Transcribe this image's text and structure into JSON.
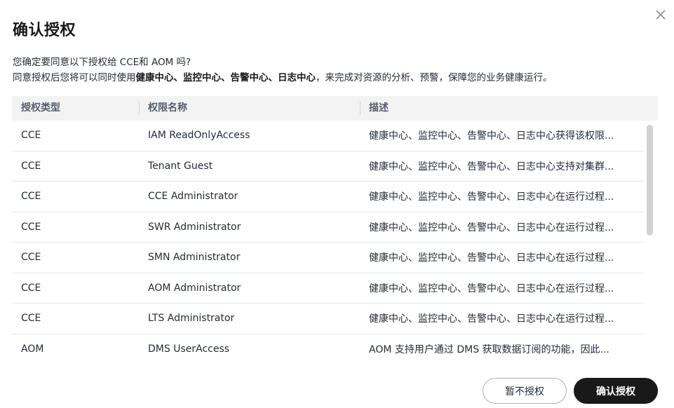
{
  "dialog": {
    "title": "确认授权",
    "desc_line1": "您确定要同意以下授权给 CCE和 AOM 吗?",
    "desc_line2_prefix": "同意授权后您将可以同时使用",
    "desc_line2_bold": "健康中心、监控中心、告警中心、日志中心",
    "desc_line2_suffix": "，来完成对资源的分析、预警，保障您的业务健康运行。",
    "close_icon": "close-icon"
  },
  "table": {
    "headers": [
      "授权类型",
      "权限名称",
      "描述"
    ],
    "rows": [
      {
        "type": "CCE",
        "name": "IAM ReadOnlyAccess",
        "desc": "健康中心、监控中心、告警中心、日志中心获得该权限..."
      },
      {
        "type": "CCE",
        "name": "Tenant Guest",
        "desc": "健康中心、监控中心、告警中心、日志中心支持对集群..."
      },
      {
        "type": "CCE",
        "name": "CCE Administrator",
        "desc": "健康中心、监控中心、告警中心、日志中心在运行过程..."
      },
      {
        "type": "CCE",
        "name": "SWR Administrator",
        "desc": "健康中心、监控中心、告警中心、日志中心在运行过程..."
      },
      {
        "type": "CCE",
        "name": "SMN Administrator",
        "desc": "健康中心、监控中心、告警中心、日志中心在运行过程..."
      },
      {
        "type": "CCE",
        "name": "AOM Administrator",
        "desc": "健康中心、监控中心、告警中心、日志中心在运行过程..."
      },
      {
        "type": "CCE",
        "name": "LTS Administrator",
        "desc": "健康中心、监控中心、告警中心、日志中心在运行过程..."
      },
      {
        "type": "AOM",
        "name": "DMS UserAccess",
        "desc": "AOM 支持用户通过 DMS 获取数据订阅的功能，因此..."
      }
    ]
  },
  "footer": {
    "cancel_label": "暂不授权",
    "confirm_label": "确认授权"
  },
  "colors": {
    "primary_button": "#191919",
    "header_bg": "#f3f3f3"
  }
}
